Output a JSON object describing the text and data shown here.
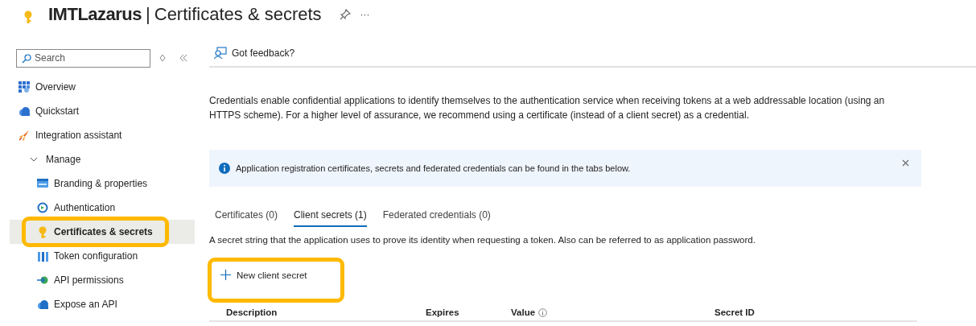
{
  "header": {
    "app": "IMTLazarus",
    "separator": "|",
    "title": "Certificates & secrets",
    "more": "···"
  },
  "sidebar": {
    "search": {
      "placeholder": "Search"
    },
    "items": [
      {
        "label": "Overview",
        "selected": false
      },
      {
        "label": "Quickstart",
        "selected": false
      },
      {
        "label": "Integration assistant",
        "selected": false
      },
      {
        "label": "Manage",
        "expanded": true,
        "children": [
          {
            "label": "Branding & properties",
            "selected": false,
            "highlighted": false
          },
          {
            "label": "Authentication",
            "selected": false,
            "highlighted": false
          },
          {
            "label": "Certificates & secrets",
            "selected": true,
            "highlighted": true
          },
          {
            "label": "Token configuration",
            "selected": false,
            "highlighted": false
          },
          {
            "label": "API permissions",
            "selected": false,
            "highlighted": false
          },
          {
            "label": "Expose an API",
            "selected": false,
            "highlighted": false
          }
        ]
      }
    ]
  },
  "toolbar": {
    "feedback": "Got feedback?"
  },
  "intro": "Credentials enable confidential applications to identify themselves to the authentication service when receiving tokens at a web addressable location (using an HTTPS scheme). For a higher level of assurance, we recommend using a certificate (instead of a client secret) as a credential.",
  "info_bar": {
    "text": "Application registration certificates, secrets and federated credentials can be found in the tabs below."
  },
  "tabs": [
    {
      "label": "Certificates (0)",
      "selected": false
    },
    {
      "label": "Client secrets (1)",
      "selected": true
    },
    {
      "label": "Federated credentials (0)",
      "selected": false
    }
  ],
  "tab_description": "A secret string that the application uses to prove its identity when requesting a token. Also can be referred to as application password.",
  "new_secret_button": {
    "label": "New client secret",
    "highlighted": true
  },
  "table": {
    "columns": [
      {
        "label": "Description",
        "info": false
      },
      {
        "label": "Expires",
        "info": false
      },
      {
        "label": "Value",
        "info": true
      },
      {
        "label": "Secret ID",
        "info": false
      }
    ]
  }
}
